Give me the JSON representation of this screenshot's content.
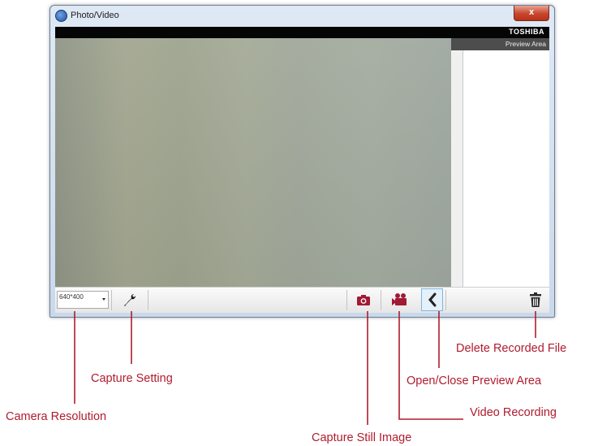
{
  "window": {
    "title": "Photo/Video",
    "close_label": "x",
    "brand": "TOSHIBA"
  },
  "preview": {
    "header": "Preview Area"
  },
  "toolbar": {
    "resolution_value": "640*400",
    "icons": [
      "wrench-icon",
      "camera-icon",
      "movie-camera-icon",
      "chevron-left-icon",
      "trash-icon"
    ]
  },
  "callouts": {
    "camera_resolution": "Camera Resolution",
    "capture_setting": "Capture Setting",
    "capture_still_image": "Capture Still Image",
    "video_recording": "Video Recording",
    "open_close_preview": "Open/Close Preview Area",
    "delete_recorded_file": "Delete Recorded File"
  },
  "colors": {
    "callout": "#b01c2e",
    "icon_accent": "#a11a33",
    "brand_bar": "#050505",
    "preview_header": "#4d4d4d"
  }
}
